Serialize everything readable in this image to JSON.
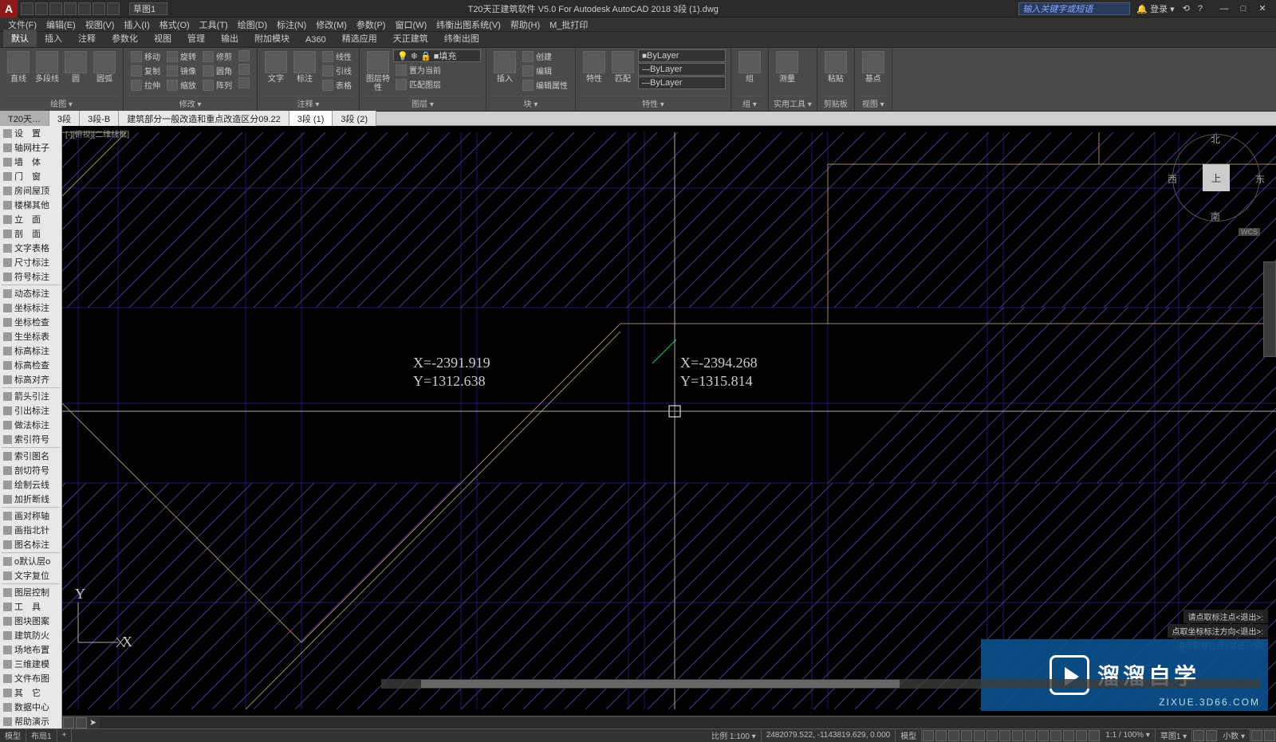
{
  "titlebar": {
    "appGlyph": "A",
    "docCombo": "草图1",
    "title": "T20天正建筑软件 V5.0 For Autodesk AutoCAD 2018    3段 (1).dwg",
    "searchPlaceholder": "输入关键字或短语",
    "login": "登录",
    "winMin": "—",
    "winMax": "□",
    "winClose": "✕"
  },
  "menubar": [
    "文件(F)",
    "编辑(E)",
    "视图(V)",
    "插入(I)",
    "格式(O)",
    "工具(T)",
    "绘图(D)",
    "标注(N)",
    "修改(M)",
    "参数(P)",
    "窗口(W)",
    "纬衡出图系统(V)",
    "帮助(H)",
    "M_批打印"
  ],
  "ribbonTabs": [
    "默认",
    "插入",
    "注释",
    "参数化",
    "视图",
    "管理",
    "输出",
    "附加模块",
    "A360",
    "精选应用",
    "天正建筑",
    "纬衡出图"
  ],
  "activeRibbonTab": "默认",
  "ribbon": {
    "draw": {
      "label": "绘图 ▾",
      "big": [
        "直线",
        "多段线",
        "圆",
        "圆弧"
      ],
      "small": []
    },
    "modify": {
      "label": "修改 ▾",
      "rows": [
        [
          "移动",
          "旋转",
          "修剪"
        ],
        [
          "复制",
          "镜像",
          "圆角"
        ],
        [
          "拉伸",
          "缩放",
          "阵列"
        ]
      ]
    },
    "annot": {
      "label": "注释 ▾",
      "big": [
        "文字",
        "标注"
      ],
      "rows": [
        [
          "线性"
        ],
        [
          "引线"
        ],
        [
          "表格"
        ]
      ]
    },
    "layers": {
      "label": "图层 ▾",
      "big": "图层特性",
      "combo1": "填充",
      "rows": [
        "置为当前",
        "匹配图层"
      ]
    },
    "block": {
      "label": "块 ▾",
      "big": "插入",
      "rows": [
        "创建",
        "编辑",
        "编辑属性"
      ]
    },
    "props": {
      "label": "特性 ▾",
      "big": [
        "特性",
        "匹配"
      ],
      "combos": [
        "ByLayer",
        "ByLayer",
        "ByLayer"
      ]
    },
    "group": {
      "label": "组 ▾",
      "big": "组"
    },
    "util": {
      "label": "实用工具 ▾",
      "big": "测量"
    },
    "clip": {
      "label": "剪贴板",
      "big": "粘贴"
    },
    "view": {
      "label": "视图 ▾",
      "big": "基点"
    }
  },
  "docTabs": {
    "left": "T20天…",
    "items": [
      "3段",
      "3段-B",
      "建筑部分一般改造和重点改造区分09.22",
      "3段 (1)",
      "3段 (2)"
    ],
    "active": 3
  },
  "leftPalette": [
    "设　置",
    "轴网柱子",
    "墙　体",
    "门　窗",
    "房间屋顶",
    "楼梯其他",
    "立　面",
    "剖　面",
    "文字表格",
    "尺寸标注",
    "符号标注",
    "-",
    "动态标注",
    "坐标标注",
    "坐标检查",
    "生坐标表",
    "标高标注",
    "标高检查",
    "标高对齐",
    "-",
    "箭头引注",
    "引出标注",
    "做法标注",
    "索引符号",
    "-",
    "索引图名",
    "剖切符号",
    "绘制云线",
    "加折断线",
    "-",
    "画对称轴",
    "画指北针",
    "图名标注",
    "-",
    "o默认层o",
    "文字复位",
    "-",
    "图层控制",
    "工　具",
    "图块图案",
    "建筑防火",
    "场地布置",
    "三维建模",
    "文件布图",
    "其　它",
    "数据中心",
    "帮助演示"
  ],
  "canvas": {
    "viewLabel": "[-][俯视][二维线框]",
    "coordA": {
      "x": "X=-2391.919",
      "y": "Y=1312.638"
    },
    "coordB": {
      "x": "X=-2394.268",
      "y": "Y=1315.814"
    },
    "viewcube": {
      "top": "上",
      "n": "北",
      "s": "南",
      "e": "东",
      "w": "西",
      "wcs": "WCS"
    },
    "ucs": {
      "x": "X",
      "y": "Y"
    }
  },
  "cmdHints": [
    "请点取标注点<退出>:",
    "点取坐标标注方向<退出>:",
    "请点取标注点<退出>:*取"
  ],
  "cmdline": {
    "prompt": ""
  },
  "statusbar": {
    "tabs": [
      "模型",
      "布局1"
    ],
    "scale": "比例 1:100 ▾",
    "coords": "2482079.522, -1143819.629, 0.000",
    "mode": "模型",
    "right": [
      "1:1 / 100% ▾",
      "草图1 ▾",
      "小数 ▾"
    ]
  },
  "watermark": {
    "title": "溜溜自学",
    "sub": "ZIXUE.3D66.COM"
  }
}
